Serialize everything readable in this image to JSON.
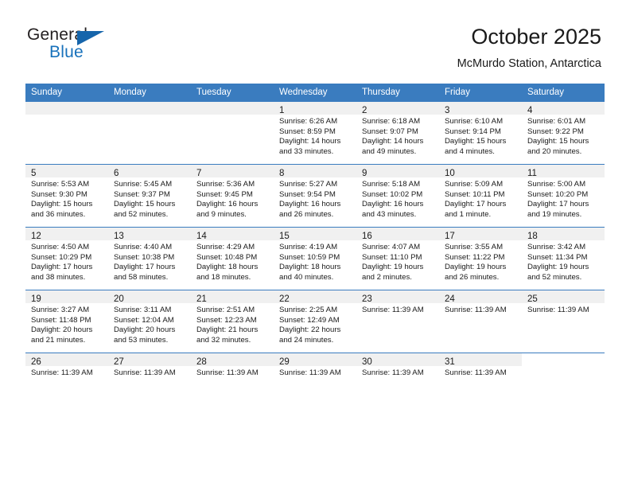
{
  "logo": {
    "word1": "General",
    "word2": "Blue",
    "triangle_color": "#1665ab",
    "word2_color": "#1771bb"
  },
  "header": {
    "title": "October 2025",
    "subtitle": "McMurdo Station, Antarctica"
  },
  "theme": {
    "header_blue": "#3a7cbf",
    "band_gray": "#f0f0f0",
    "text": "#1a1a1a"
  },
  "weekdays": [
    "Sunday",
    "Monday",
    "Tuesday",
    "Wednesday",
    "Thursday",
    "Friday",
    "Saturday"
  ],
  "weeks": [
    [
      {
        "empty": true
      },
      {
        "empty": true
      },
      {
        "empty": true
      },
      {
        "day": "1",
        "sunrise": "Sunrise: 6:26 AM",
        "sunset": "Sunset: 8:59 PM",
        "daylight": "Daylight: 14 hours and 33 minutes."
      },
      {
        "day": "2",
        "sunrise": "Sunrise: 6:18 AM",
        "sunset": "Sunset: 9:07 PM",
        "daylight": "Daylight: 14 hours and 49 minutes."
      },
      {
        "day": "3",
        "sunrise": "Sunrise: 6:10 AM",
        "sunset": "Sunset: 9:14 PM",
        "daylight": "Daylight: 15 hours and 4 minutes."
      },
      {
        "day": "4",
        "sunrise": "Sunrise: 6:01 AM",
        "sunset": "Sunset: 9:22 PM",
        "daylight": "Daylight: 15 hours and 20 minutes."
      }
    ],
    [
      {
        "day": "5",
        "sunrise": "Sunrise: 5:53 AM",
        "sunset": "Sunset: 9:30 PM",
        "daylight": "Daylight: 15 hours and 36 minutes."
      },
      {
        "day": "6",
        "sunrise": "Sunrise: 5:45 AM",
        "sunset": "Sunset: 9:37 PM",
        "daylight": "Daylight: 15 hours and 52 minutes."
      },
      {
        "day": "7",
        "sunrise": "Sunrise: 5:36 AM",
        "sunset": "Sunset: 9:45 PM",
        "daylight": "Daylight: 16 hours and 9 minutes."
      },
      {
        "day": "8",
        "sunrise": "Sunrise: 5:27 AM",
        "sunset": "Sunset: 9:54 PM",
        "daylight": "Daylight: 16 hours and 26 minutes."
      },
      {
        "day": "9",
        "sunrise": "Sunrise: 5:18 AM",
        "sunset": "Sunset: 10:02 PM",
        "daylight": "Daylight: 16 hours and 43 minutes."
      },
      {
        "day": "10",
        "sunrise": "Sunrise: 5:09 AM",
        "sunset": "Sunset: 10:11 PM",
        "daylight": "Daylight: 17 hours and 1 minute."
      },
      {
        "day": "11",
        "sunrise": "Sunrise: 5:00 AM",
        "sunset": "Sunset: 10:20 PM",
        "daylight": "Daylight: 17 hours and 19 minutes."
      }
    ],
    [
      {
        "day": "12",
        "sunrise": "Sunrise: 4:50 AM",
        "sunset": "Sunset: 10:29 PM",
        "daylight": "Daylight: 17 hours and 38 minutes."
      },
      {
        "day": "13",
        "sunrise": "Sunrise: 4:40 AM",
        "sunset": "Sunset: 10:38 PM",
        "daylight": "Daylight: 17 hours and 58 minutes."
      },
      {
        "day": "14",
        "sunrise": "Sunrise: 4:29 AM",
        "sunset": "Sunset: 10:48 PM",
        "daylight": "Daylight: 18 hours and 18 minutes."
      },
      {
        "day": "15",
        "sunrise": "Sunrise: 4:19 AM",
        "sunset": "Sunset: 10:59 PM",
        "daylight": "Daylight: 18 hours and 40 minutes."
      },
      {
        "day": "16",
        "sunrise": "Sunrise: 4:07 AM",
        "sunset": "Sunset: 11:10 PM",
        "daylight": "Daylight: 19 hours and 2 minutes."
      },
      {
        "day": "17",
        "sunrise": "Sunrise: 3:55 AM",
        "sunset": "Sunset: 11:22 PM",
        "daylight": "Daylight: 19 hours and 26 minutes."
      },
      {
        "day": "18",
        "sunrise": "Sunrise: 3:42 AM",
        "sunset": "Sunset: 11:34 PM",
        "daylight": "Daylight: 19 hours and 52 minutes."
      }
    ],
    [
      {
        "day": "19",
        "sunrise": "Sunrise: 3:27 AM",
        "sunset": "Sunset: 11:48 PM",
        "daylight": "Daylight: 20 hours and 21 minutes."
      },
      {
        "day": "20",
        "sunrise": "Sunrise: 3:11 AM",
        "sunset": "Sunset: 12:04 AM",
        "daylight": "Daylight: 20 hours and 53 minutes."
      },
      {
        "day": "21",
        "sunrise": "Sunrise: 2:51 AM",
        "sunset": "Sunset: 12:23 AM",
        "daylight": "Daylight: 21 hours and 32 minutes."
      },
      {
        "day": "22",
        "sunrise": "Sunrise: 2:25 AM",
        "sunset": "Sunset: 12:49 AM",
        "daylight": "Daylight: 22 hours and 24 minutes."
      },
      {
        "day": "23",
        "sunrise": "Sunrise: 11:39 AM",
        "sunset": "",
        "daylight": ""
      },
      {
        "day": "24",
        "sunrise": "Sunrise: 11:39 AM",
        "sunset": "",
        "daylight": ""
      },
      {
        "day": "25",
        "sunrise": "Sunrise: 11:39 AM",
        "sunset": "",
        "daylight": ""
      }
    ],
    [
      {
        "day": "26",
        "sunrise": "Sunrise: 11:39 AM",
        "sunset": "",
        "daylight": ""
      },
      {
        "day": "27",
        "sunrise": "Sunrise: 11:39 AM",
        "sunset": "",
        "daylight": ""
      },
      {
        "day": "28",
        "sunrise": "Sunrise: 11:39 AM",
        "sunset": "",
        "daylight": ""
      },
      {
        "day": "29",
        "sunrise": "Sunrise: 11:39 AM",
        "sunset": "",
        "daylight": ""
      },
      {
        "day": "30",
        "sunrise": "Sunrise: 11:39 AM",
        "sunset": "",
        "daylight": ""
      },
      {
        "day": "31",
        "sunrise": "Sunrise: 11:39 AM",
        "sunset": "",
        "daylight": ""
      },
      {
        "empty": true
      }
    ]
  ]
}
